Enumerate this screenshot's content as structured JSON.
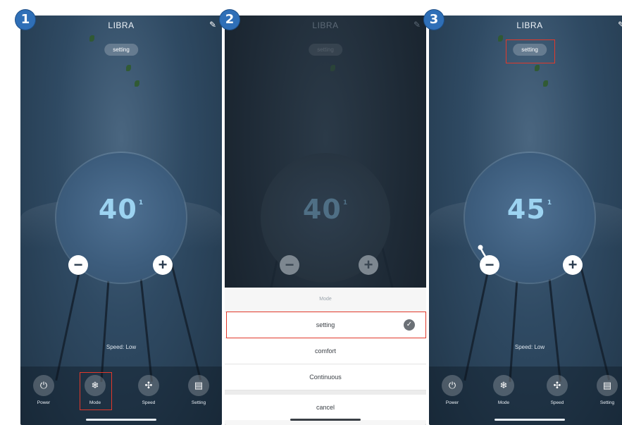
{
  "steps": [
    "1",
    "2",
    "3"
  ],
  "screen1": {
    "title": "LIBRA",
    "mode_badge": "setting",
    "value": "40",
    "unit": "1",
    "minus": "−",
    "plus": "+",
    "speed_text": "Speed: Low",
    "bottom": [
      {
        "label": "Power",
        "icon": "power-icon",
        "glyph": "⏻"
      },
      {
        "label": "Mode",
        "icon": "mode-icon",
        "glyph": "❄"
      },
      {
        "label": "Speed",
        "icon": "fan-icon",
        "glyph": "✣"
      },
      {
        "label": "Setting",
        "icon": "settings-icon",
        "glyph": "▤"
      }
    ]
  },
  "screen2": {
    "title": "LIBRA",
    "mode_badge": "setting",
    "value": "40",
    "unit": "1",
    "minus": "−",
    "plus": "+",
    "sheet_title": "Mode",
    "options": [
      "setting",
      "comfort",
      "Continuous"
    ],
    "selected": "setting",
    "cancel": "cancel"
  },
  "screen3": {
    "title": "LIBRA",
    "mode_badge": "setting",
    "value": "45",
    "unit": "1",
    "minus": "−",
    "plus": "+",
    "speed_text": "Speed: Low",
    "bottom": [
      {
        "label": "Power",
        "icon": "power-icon",
        "glyph": "⏻"
      },
      {
        "label": "Mode",
        "icon": "mode-icon",
        "glyph": "❄"
      },
      {
        "label": "Speed",
        "icon": "fan-icon",
        "glyph": "✣"
      },
      {
        "label": "Setting",
        "icon": "settings-icon",
        "glyph": "▤"
      }
    ]
  },
  "colors": {
    "highlight": "#e1392b",
    "step_badge": "#2f6fb7",
    "digits": "#9cd3f1"
  }
}
